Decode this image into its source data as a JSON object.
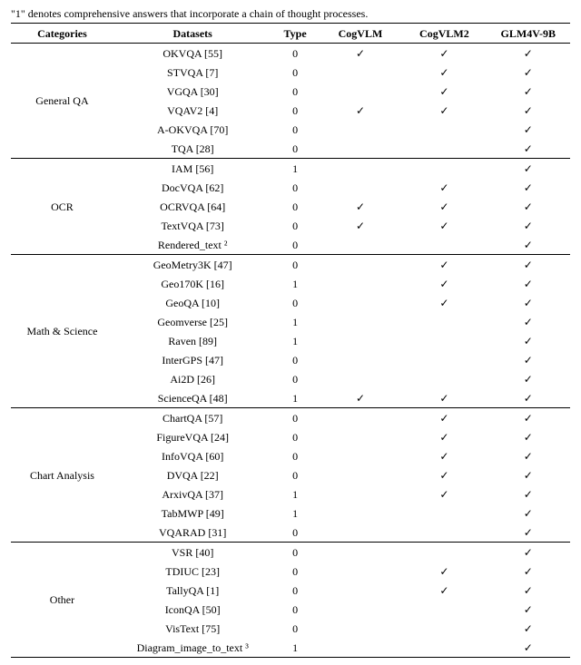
{
  "caption": "\"1\" denotes comprehensive answers that incorporate a chain of thought processes.",
  "headers": {
    "categories": "Categories",
    "datasets": "Datasets",
    "type": "Type",
    "m1": "CogVLM",
    "m2": "CogVLM2",
    "m3": "GLM4V-9B"
  },
  "check": "✓",
  "groups": [
    {
      "category": "General QA",
      "rows": [
        {
          "ds": "OKVQA [55]",
          "type": "0",
          "m1": true,
          "m2": true,
          "m3": true
        },
        {
          "ds": "STVQA [7]",
          "type": "0",
          "m1": false,
          "m2": true,
          "m3": true
        },
        {
          "ds": "VGQA [30]",
          "type": "0",
          "m1": false,
          "m2": true,
          "m3": true
        },
        {
          "ds": "VQAV2 [4]",
          "type": "0",
          "m1": true,
          "m2": true,
          "m3": true
        },
        {
          "ds": "A-OKVQA [70]",
          "type": "0",
          "m1": false,
          "m2": false,
          "m3": true
        },
        {
          "ds": "TQA [28]",
          "type": "0",
          "m1": false,
          "m2": false,
          "m3": true
        }
      ]
    },
    {
      "category": "OCR",
      "rows": [
        {
          "ds": "IAM [56]",
          "type": "1",
          "m1": false,
          "m2": false,
          "m3": true
        },
        {
          "ds": "DocVQA [62]",
          "type": "0",
          "m1": false,
          "m2": true,
          "m3": true
        },
        {
          "ds": "OCRVQA [64]",
          "type": "0",
          "m1": true,
          "m2": true,
          "m3": true
        },
        {
          "ds": "TextVQA [73]",
          "type": "0",
          "m1": true,
          "m2": true,
          "m3": true
        },
        {
          "ds": "Rendered_text ²",
          "type": "0",
          "m1": false,
          "m2": false,
          "m3": true
        }
      ]
    },
    {
      "category": "Math & Science",
      "rows": [
        {
          "ds": "GeoMetry3K [47]",
          "type": "0",
          "m1": false,
          "m2": true,
          "m3": true
        },
        {
          "ds": "Geo170K [16]",
          "type": "1",
          "m1": false,
          "m2": true,
          "m3": true
        },
        {
          "ds": "GeoQA [10]",
          "type": "0",
          "m1": false,
          "m2": true,
          "m3": true
        },
        {
          "ds": "Geomverse [25]",
          "type": "1",
          "m1": false,
          "m2": false,
          "m3": true
        },
        {
          "ds": "Raven [89]",
          "type": "1",
          "m1": false,
          "m2": false,
          "m3": true
        },
        {
          "ds": "InterGPS [47]",
          "type": "0",
          "m1": false,
          "m2": false,
          "m3": true
        },
        {
          "ds": "Ai2D [26]",
          "type": "0",
          "m1": false,
          "m2": false,
          "m3": true
        },
        {
          "ds": "ScienceQA [48]",
          "type": "1",
          "m1": true,
          "m2": true,
          "m3": true
        }
      ]
    },
    {
      "category": "Chart Analysis",
      "rows": [
        {
          "ds": "ChartQA [57]",
          "type": "0",
          "m1": false,
          "m2": true,
          "m3": true
        },
        {
          "ds": "FigureVQA [24]",
          "type": "0",
          "m1": false,
          "m2": true,
          "m3": true
        },
        {
          "ds": "InfoVQA [60]",
          "type": "0",
          "m1": false,
          "m2": true,
          "m3": true
        },
        {
          "ds": "DVQA [22]",
          "type": "0",
          "m1": false,
          "m2": true,
          "m3": true
        },
        {
          "ds": "ArxivQA [37]",
          "type": "1",
          "m1": false,
          "m2": true,
          "m3": true
        },
        {
          "ds": "TabMWP [49]",
          "type": "1",
          "m1": false,
          "m2": false,
          "m3": true
        },
        {
          "ds": "VQARAD [31]",
          "type": "0",
          "m1": false,
          "m2": false,
          "m3": true
        }
      ]
    },
    {
      "category": "Other",
      "rows": [
        {
          "ds": "VSR [40]",
          "type": "0",
          "m1": false,
          "m2": false,
          "m3": true
        },
        {
          "ds": "TDIUC [23]",
          "type": "0",
          "m1": false,
          "m2": true,
          "m3": true
        },
        {
          "ds": "TallyQA [1]",
          "type": "0",
          "m1": false,
          "m2": true,
          "m3": true
        },
        {
          "ds": "IconQA [50]",
          "type": "0",
          "m1": false,
          "m2": false,
          "m3": true
        },
        {
          "ds": "VisText [75]",
          "type": "0",
          "m1": false,
          "m2": false,
          "m3": true
        },
        {
          "ds": "Diagram_image_to_text ³",
          "type": "1",
          "m1": false,
          "m2": false,
          "m3": true
        }
      ]
    }
  ]
}
